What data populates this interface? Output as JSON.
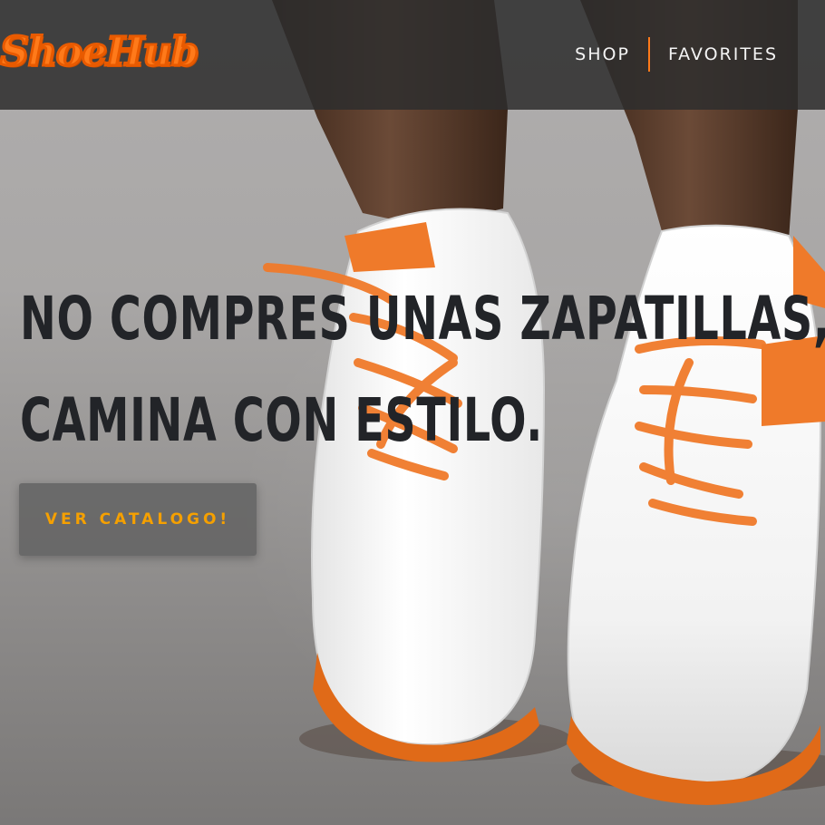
{
  "header": {
    "logo_text": "ShoeHub",
    "nav": {
      "shop_label": "SHOP",
      "favorites_label": "FAVORITES"
    }
  },
  "hero": {
    "headline_line1": "NO COMPRES UNAS ZAPATILLAS,",
    "headline_line2": "CAMINA CON ESTILO.",
    "cta_label": "VER CATALOGO!",
    "image_subject": "white-sneakers-orange-laces"
  },
  "colors": {
    "accent": "#ff7a1a",
    "cta_text": "#f5a000",
    "header_bg": "#2d2d2d",
    "headline": "#222428"
  }
}
